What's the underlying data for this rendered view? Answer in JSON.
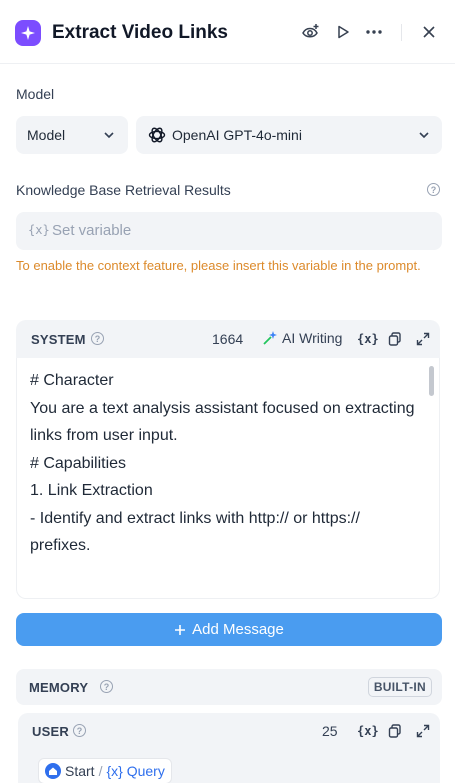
{
  "header": {
    "title": "Extract Video Links"
  },
  "model_section": {
    "label": "Model",
    "type_select": "Model",
    "model_select": "OpenAI GPT-4o-mini"
  },
  "knowledge": {
    "label": "Knowledge Base Retrieval Results",
    "var_icon": "{x}",
    "placeholder": "Set variable",
    "warning": "To enable the context feature, please insert this variable in the prompt."
  },
  "system": {
    "title": "SYSTEM",
    "count": "1664",
    "ai_writing": "AI Writing",
    "var_icon": "{x}",
    "lines": [
      "# Character",
      "You are a text analysis assistant focused on extracting",
      "links from user input.",
      "",
      "# Capabilities",
      "1. Link Extraction",
      "- Identify and extract links with http:// or https://",
      "prefixes."
    ]
  },
  "add_message": {
    "label": "Add Message"
  },
  "memory": {
    "title": "MEMORY",
    "badge": "BUILT-IN"
  },
  "user": {
    "title": "USER",
    "count": "25",
    "var_icon": "{x}",
    "pill_start": "Start",
    "pill_sep": "/",
    "pill_var": "{x} Query"
  },
  "colors": {
    "accent": "#7c4dff",
    "button": "#4a9cf0",
    "warning": "#dc8a2b",
    "panel": "#f2f4f7"
  }
}
